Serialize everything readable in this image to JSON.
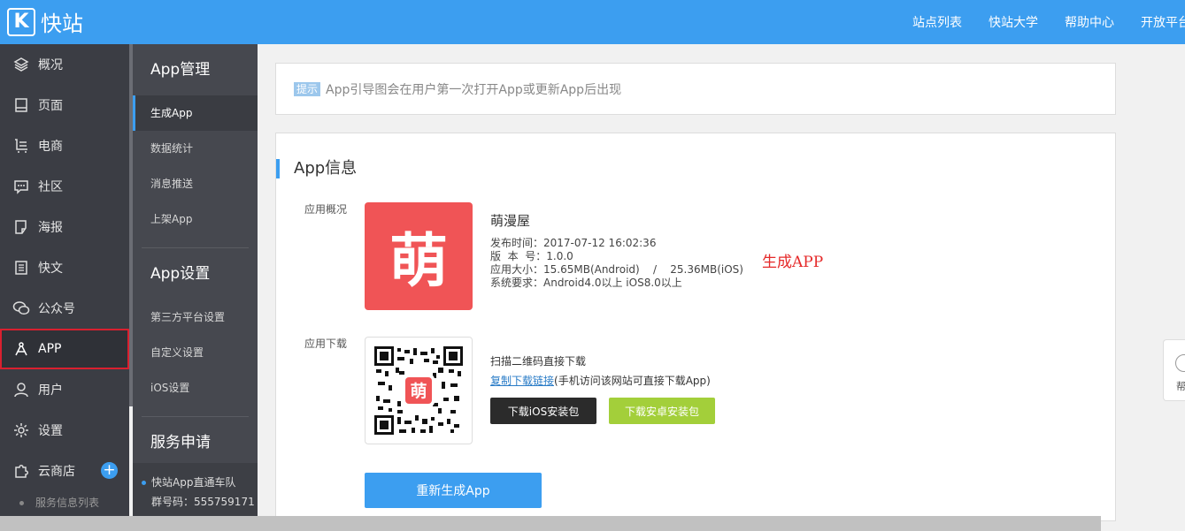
{
  "brand": {
    "name": "快站",
    "logo_letter": "K"
  },
  "topnav": [
    "站点列表",
    "快站大学",
    "帮助中心",
    "开放平台"
  ],
  "sidebar": {
    "items": [
      {
        "label": "概况",
        "icon": "layers-icon"
      },
      {
        "label": "页面",
        "icon": "page-icon"
      },
      {
        "label": "电商",
        "icon": "cart-icon"
      },
      {
        "label": "社区",
        "icon": "chat-icon"
      },
      {
        "label": "海报",
        "icon": "poster-icon"
      },
      {
        "label": "快文",
        "icon": "document-icon"
      },
      {
        "label": "公众号",
        "icon": "wechat-icon"
      },
      {
        "label": "APP",
        "icon": "app-icon"
      },
      {
        "label": "用户",
        "icon": "user-icon"
      },
      {
        "label": "设置",
        "icon": "gear-icon"
      },
      {
        "label": "云商店",
        "icon": "puzzle-icon"
      }
    ],
    "sub_item": "服务信息列表"
  },
  "subnav": {
    "app_manage_title": "App管理",
    "app_manage_items": [
      "生成App",
      "数据统计",
      "消息推送",
      "上架App"
    ],
    "app_settings_title": "App设置",
    "app_settings_items": [
      "第三方平台设置",
      "自定义设置",
      "iOS设置"
    ],
    "service_title": "服务申请",
    "footer_line1": "快站App直通车队",
    "footer_line2": "群号码：555759171"
  },
  "tip": {
    "tag": "提示",
    "text": "App引导图会在用户第一次打开App或更新App后出现"
  },
  "app_info": {
    "title": "App信息",
    "overview_label": "应用概况",
    "icon_char": "萌",
    "name": "萌漫屋",
    "publish_time": "发布时间：2017-07-12 16:02:36",
    "version": "版  本  号：1.0.0",
    "size": "应用大小：15.65MB(Android)    /    25.36MB(iOS)",
    "requirements": "系统要求：Android4.0以上 iOS8.0以上",
    "annotation": "生成APP",
    "download_label": "应用下载",
    "scan_text": "扫描二维码直接下载",
    "copy_link": "复制下载链接",
    "copy_link_note": "(手机访问该网站可直接下载App)",
    "btn_ios": "下载iOS安装包",
    "btn_android": "下载安卓安装包",
    "btn_regenerate": "重新生成App",
    "qr_center_char": "萌"
  },
  "floater": {
    "label": "帮"
  },
  "colors": {
    "topbar": "#3c9ef0",
    "sidebar": "#3b3d44",
    "accent": "#3c9ef0",
    "app_icon": "#f05456",
    "android_btn": "#a3cf3a",
    "annotation": "#e52a2a"
  }
}
